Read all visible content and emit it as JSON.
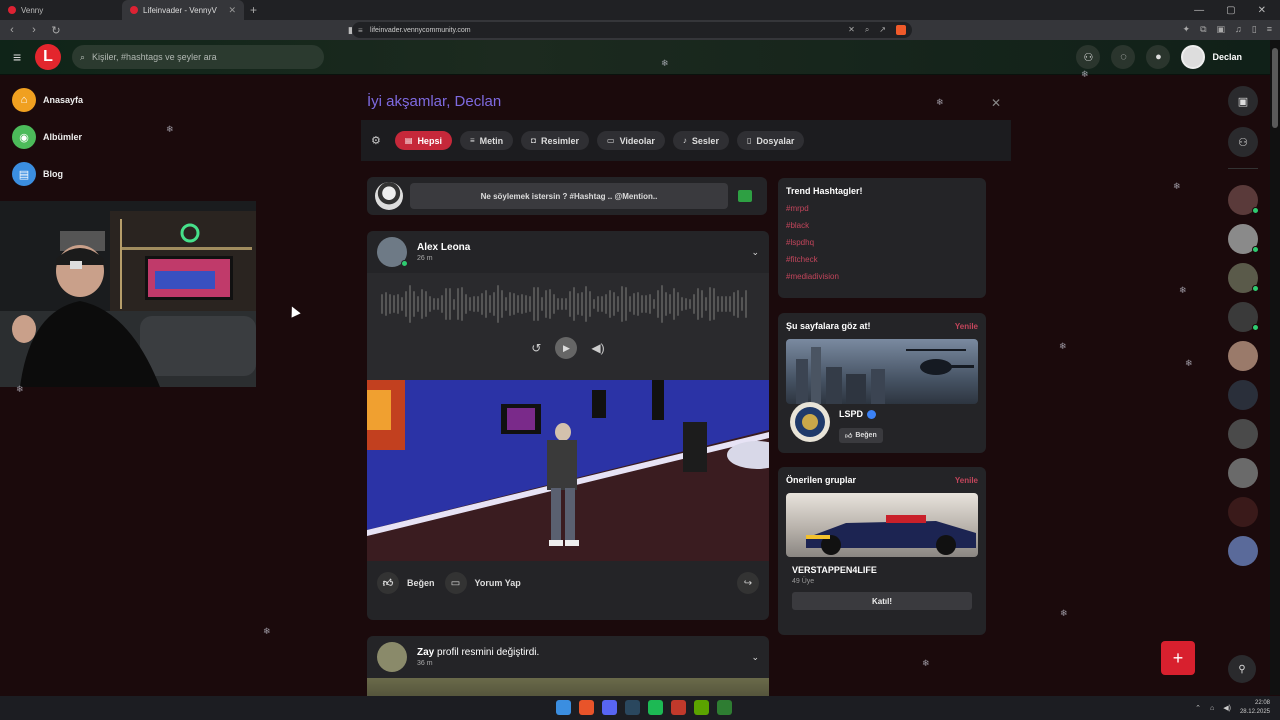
{
  "browser": {
    "tabs": [
      {
        "label": "Venny",
        "active": false
      },
      {
        "label": "Lifeinvader - VennyV",
        "active": true
      }
    ],
    "url": "lifeinvader.vennycommunity.com"
  },
  "header": {
    "search_placeholder": "Kişiler, #hashtags ve şeyler ara",
    "user_name": "Declan",
    "logo_letter": "L"
  },
  "sidebar": {
    "items": [
      {
        "label": "Anasayfa",
        "color": "#f0a020",
        "icon": "home-icon"
      },
      {
        "label": "Albümler",
        "color": "#4cbb5a",
        "icon": "album-icon"
      },
      {
        "label": "Blog",
        "color": "#3b8ee0",
        "icon": "blog-icon"
      }
    ]
  },
  "main": {
    "greeting": "İyi akşamlar, Declan",
    "filters": [
      {
        "label": "Hepsi",
        "icon": "list-icon",
        "active": true
      },
      {
        "label": "Metin",
        "icon": "text-icon",
        "active": false
      },
      {
        "label": "Resimler",
        "icon": "camera-icon",
        "active": false
      },
      {
        "label": "Videolar",
        "icon": "video-icon",
        "active": false
      },
      {
        "label": "Sesler",
        "icon": "music-icon",
        "active": false
      },
      {
        "label": "Dosyalar",
        "icon": "file-icon",
        "active": false
      }
    ],
    "composer_placeholder": "Ne söylemek istersin ? #Hashtag .. @Mention..",
    "post": {
      "author": "Alex Leona",
      "time": "26 m",
      "like_label": "Beğen",
      "comment_label": "Yorum Yap"
    },
    "post2": {
      "author": "Zay",
      "action": "profil resmini değiştirdi.",
      "time": "36 m"
    }
  },
  "trending": {
    "title": "Trend Hashtagler!",
    "tags": [
      "#mrpd",
      "#black",
      "#lspdhq",
      "#fitcheck",
      "#mediadivision"
    ]
  },
  "pages_widget": {
    "title": "Şu sayfalara göz at!",
    "refresh": "Yenile",
    "page_name": "LSPD",
    "like_label": "Beğen"
  },
  "groups_widget": {
    "title": "Önerilen gruplar",
    "refresh": "Yenile",
    "group_name": "VERSTAPPEN4LIFE",
    "members": "49 Üye",
    "join_label": "Katıl!"
  },
  "taskbar": {
    "time": "22:08",
    "date": "28.12.2025"
  },
  "colors": {
    "accent": "#c6283a",
    "greeting": "#7e6ae0",
    "hashtag": "#c2455b",
    "online": "#2ecc71"
  }
}
